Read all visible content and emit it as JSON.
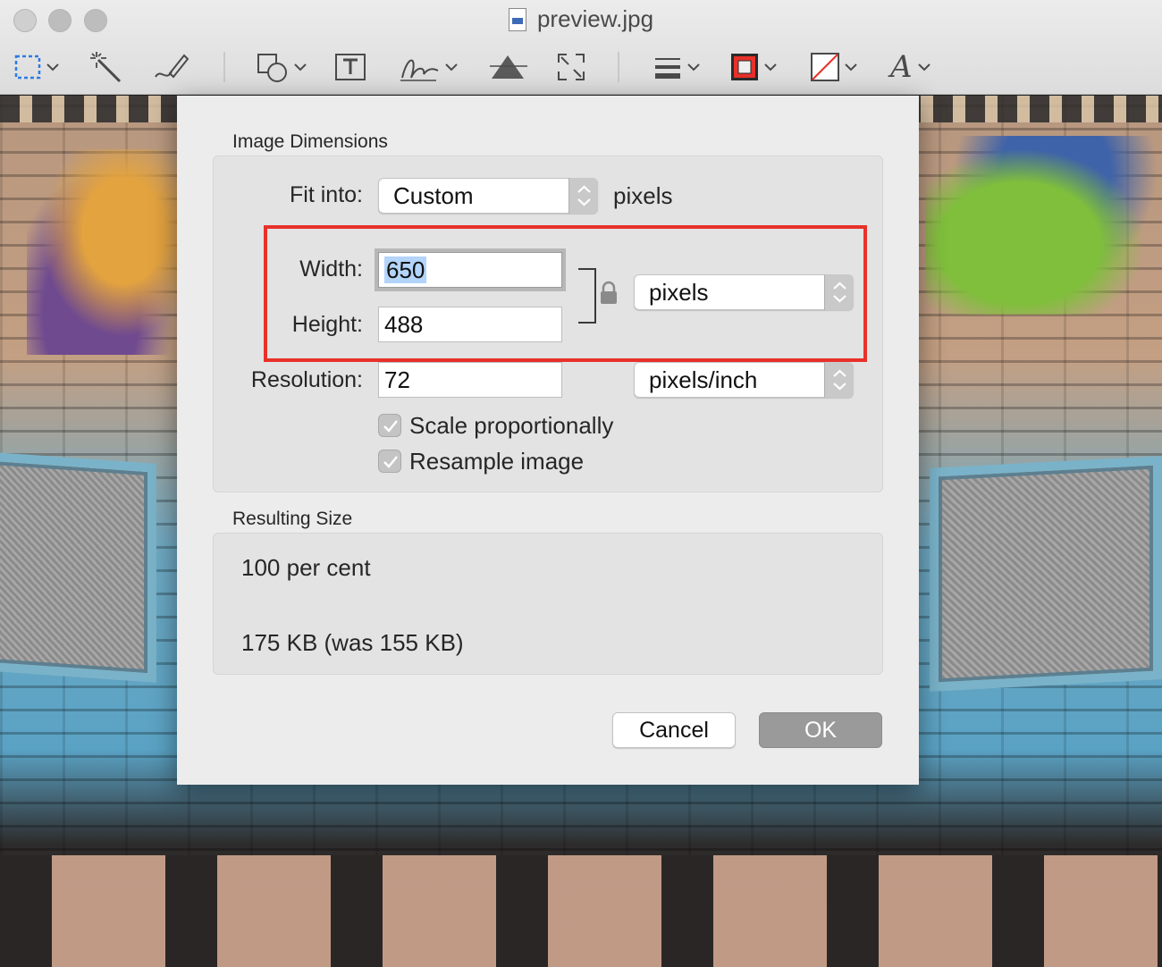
{
  "window": {
    "title": "preview.jpg"
  },
  "toolbar": {
    "tools": [
      {
        "name": "rectangular-selection-icon"
      },
      {
        "name": "instant-alpha-icon"
      },
      {
        "name": "sketch-icon"
      },
      {
        "name": "shapes-icon"
      },
      {
        "name": "text-box-icon"
      },
      {
        "name": "signature-icon"
      },
      {
        "name": "adjust-color-icon"
      },
      {
        "name": "adjust-size-icon"
      },
      {
        "name": "shape-style-icon"
      },
      {
        "name": "border-color-icon",
        "color": "#e8312a"
      },
      {
        "name": "fill-color-icon"
      },
      {
        "name": "text-style-icon",
        "glyph": "A"
      }
    ]
  },
  "dialog": {
    "image_dimensions_title": "Image Dimensions",
    "fit_into_label": "Fit into:",
    "fit_into_value": "Custom",
    "fit_into_unit": "pixels",
    "width_label": "Width:",
    "width_value": "650",
    "height_label": "Height:",
    "height_value": "488",
    "size_unit": "pixels",
    "resolution_label": "Resolution:",
    "resolution_value": "72",
    "resolution_unit": "pixels/inch",
    "scale_proportionally": {
      "label": "Scale proportionally",
      "checked": true
    },
    "resample_image": {
      "label": "Resample image",
      "checked": true
    },
    "resulting_size_title": "Resulting Size",
    "percent_text": "100 per cent",
    "filesize_text": "175 KB (was 155 KB)",
    "cancel_label": "Cancel",
    "ok_label": "OK"
  },
  "colors": {
    "highlight_box": "#e8312a",
    "selection": "#b3d4fb"
  }
}
